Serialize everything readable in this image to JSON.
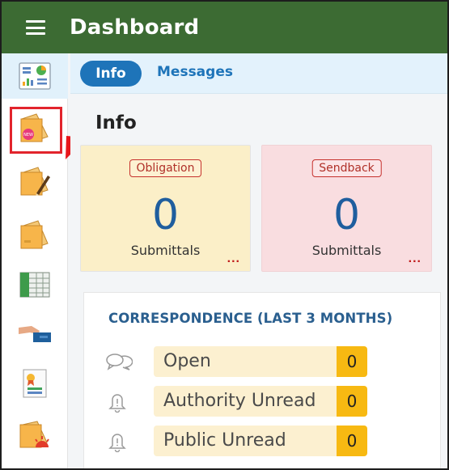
{
  "header": {
    "title": "Dashboard",
    "menu_icon": "hamburger-menu-icon"
  },
  "sidebar": {
    "items": [
      {
        "icon": "dashboard-report-icon"
      },
      {
        "icon": "new-folder-icon"
      },
      {
        "icon": "edit-folder-icon"
      },
      {
        "icon": "folder-icon"
      },
      {
        "icon": "ledger-icon"
      },
      {
        "icon": "handshake-icon"
      },
      {
        "icon": "certificate-icon"
      },
      {
        "icon": "alert-folder-icon"
      }
    ]
  },
  "tabs": [
    {
      "label": "Info",
      "active": true
    },
    {
      "label": "Messages",
      "active": false
    }
  ],
  "main": {
    "title": "Info",
    "cards": [
      {
        "badge": "Obligation",
        "count": "0",
        "label": "Submittals",
        "more": "...",
        "color": "#fbefc8"
      },
      {
        "badge": "Sendback",
        "count": "0",
        "label": "Submittals",
        "more": "...",
        "color": "#f9dde0"
      }
    ],
    "correspondence": {
      "title": "CORRESPONDENCE (LAST 3 MONTHS)",
      "rows": [
        {
          "icon": "chat-bubbles-icon",
          "label": "Open",
          "count": "0"
        },
        {
          "icon": "bell-icon",
          "label": "Authority Unread",
          "count": "0"
        },
        {
          "icon": "bell-icon",
          "label": "Public Unread",
          "count": "0"
        }
      ]
    }
  },
  "colors": {
    "header_bg": "#3c6b33",
    "accent": "#1e74b9",
    "highlight": "#e2242c",
    "count_badge": "#f7b912"
  }
}
